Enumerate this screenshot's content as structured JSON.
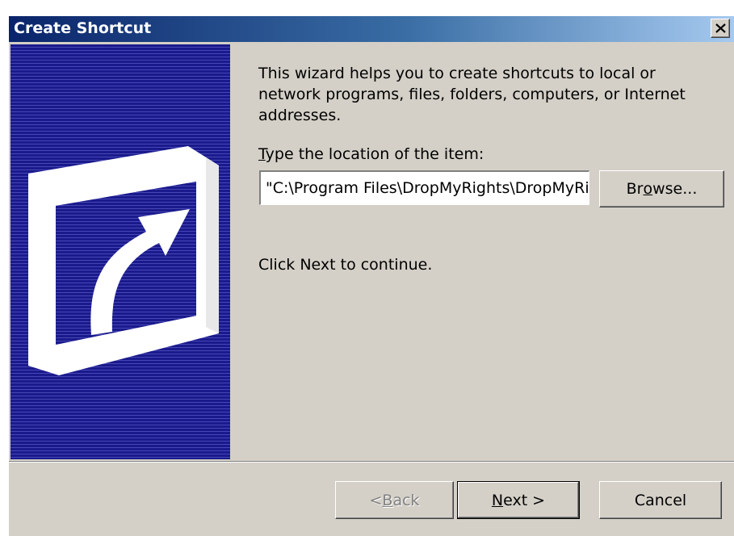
{
  "window": {
    "title": "Create Shortcut",
    "close_glyph": "✕"
  },
  "banner": {
    "icon": "shortcut-arrow-icon",
    "colors": {
      "background": "#1a1a8c",
      "stripe": "#4646b4",
      "icon": "#ffffff"
    }
  },
  "content": {
    "description": "This wizard helps you to create shortcuts to local or network programs, files, folders, computers, or Internet addresses.",
    "location_label_mnemonic": "T",
    "location_label_rest": "ype the location of the item:",
    "location_value": "\"C:\\Program Files\\DropMyRights\\DropMyRights.exe\"",
    "browse_pre": "Br",
    "browse_mnemonic": "o",
    "browse_post": "wse...",
    "continue_text": "Click Next to continue."
  },
  "footer": {
    "back_pre": "< ",
    "back_mnemonic": "B",
    "back_post": "ack",
    "next_mnemonic": "N",
    "next_post": "ext >",
    "cancel_label": "Cancel"
  },
  "colors": {
    "window_bg": "#d4d0c8",
    "titlebar_start": "#0a246a",
    "titlebar_end": "#a6caf0",
    "disabled_text": "#808080"
  }
}
